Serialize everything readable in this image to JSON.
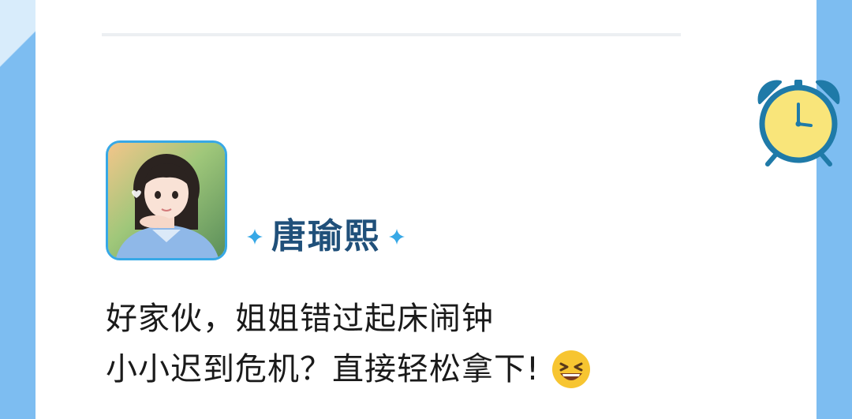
{
  "post": {
    "author_name": "唐瑜熙",
    "message_lines": [
      "好家伙，姐姐错过起床闹钟",
      "小小迟到危机？直接轻松拿下!"
    ]
  },
  "icons": {
    "clock": "alarm-clock-icon",
    "emoji": "laughing-squint-emoji-icon",
    "sparkle": "sparkle-icon"
  },
  "colors": {
    "background": "#7dbdf1",
    "card": "#ffffff",
    "name": "#20507a",
    "accent": "#37a8e6",
    "clock_face": "#f9e57a",
    "clock_frame": "#1f7aa8"
  }
}
